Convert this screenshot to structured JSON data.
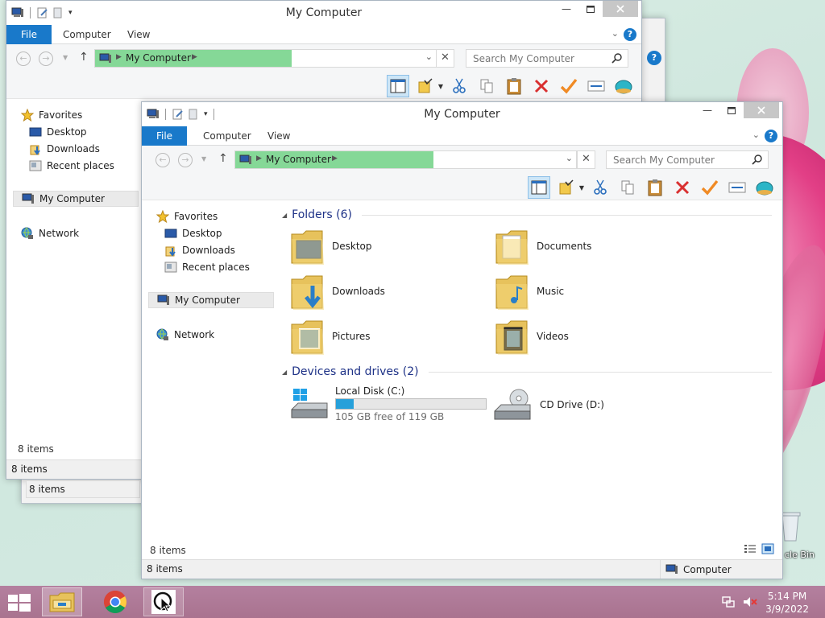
{
  "window": {
    "title": "My Computer",
    "tabs": [
      "File",
      "Computer",
      "View"
    ],
    "address": "My Computer",
    "search_placeholder": "Search My Computer",
    "help": "?"
  },
  "nav": {
    "favorites": "Favorites",
    "desktop": "Desktop",
    "downloads": "Downloads",
    "recent": "Recent places",
    "my_computer": "My Computer",
    "network": "Network"
  },
  "folders": {
    "header": "Folders (6)",
    "items": [
      "Desktop",
      "Documents",
      "Downloads",
      "Music",
      "Pictures",
      "Videos"
    ]
  },
  "devices": {
    "header": "Devices and drives (2)",
    "local_disk": {
      "name": "Local Disk (C:)",
      "free": "105 GB free of 119 GB",
      "used_fraction": 0.118
    },
    "cd_drive": "CD Drive (D:)"
  },
  "status": {
    "items": "8 items",
    "computer": "Computer"
  },
  "desktop": {
    "recycle_partial": "cle Bin"
  },
  "taskbar": {
    "time": "5:14 PM",
    "date": "3/9/2022"
  }
}
